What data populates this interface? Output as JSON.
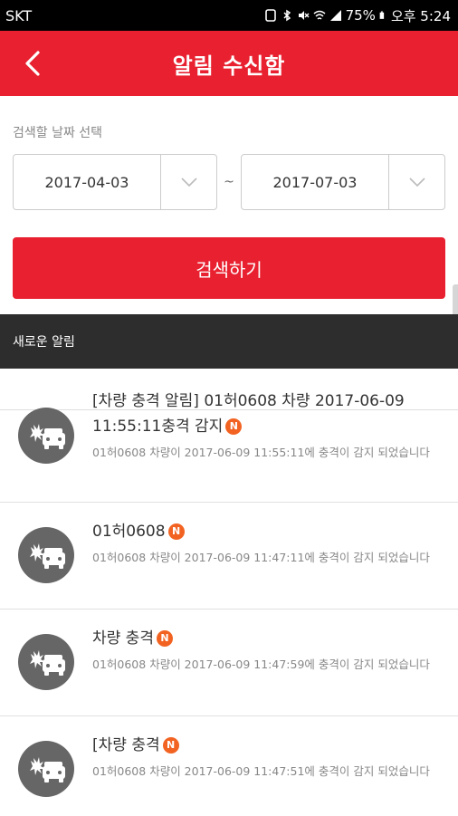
{
  "status_bar": {
    "carrier": "SKT",
    "battery": "75%",
    "time": "오후 5:24"
  },
  "header": {
    "title": "알림 수신함"
  },
  "search": {
    "date_label": "검색할 날짜 선택",
    "start_date": "2017-04-03",
    "separator": "~",
    "end_date": "2017-07-03",
    "button_label": "검색하기"
  },
  "section": {
    "title": "새로운 알림"
  },
  "notifications": [
    {
      "title": "[차량 충격 알림] 01허0608 차량 2017-06-09 11:55:11충격 감지",
      "badge": "N",
      "body": "01허0608 차량이 2017-06-09 11:55:11에 충격이 감지 되었습니다"
    },
    {
      "title": "01허0608",
      "badge": "N",
      "body": "01허0608 차량이 2017-06-09 11:47:11에 충격이 감지 되었습니다"
    },
    {
      "title": "차량 충격",
      "badge": "N",
      "body": "01허0608 차량이 2017-06-09 11:47:59에 충격이 감지 되었습니다"
    },
    {
      "title": "[차량 충격",
      "badge": "N",
      "body": "01허0608 차량이 2017-06-09 11:47:51에 충격이 감지 되었습니다"
    }
  ],
  "colors": {
    "accent": "#e8202f",
    "badge": "#f26322",
    "section_bar": "#2d2d2d",
    "icon": "#666666"
  },
  "icons": {
    "back": "chevron-left-icon",
    "dropdown": "chevron-down-icon",
    "notification": "car-crash-icon"
  }
}
